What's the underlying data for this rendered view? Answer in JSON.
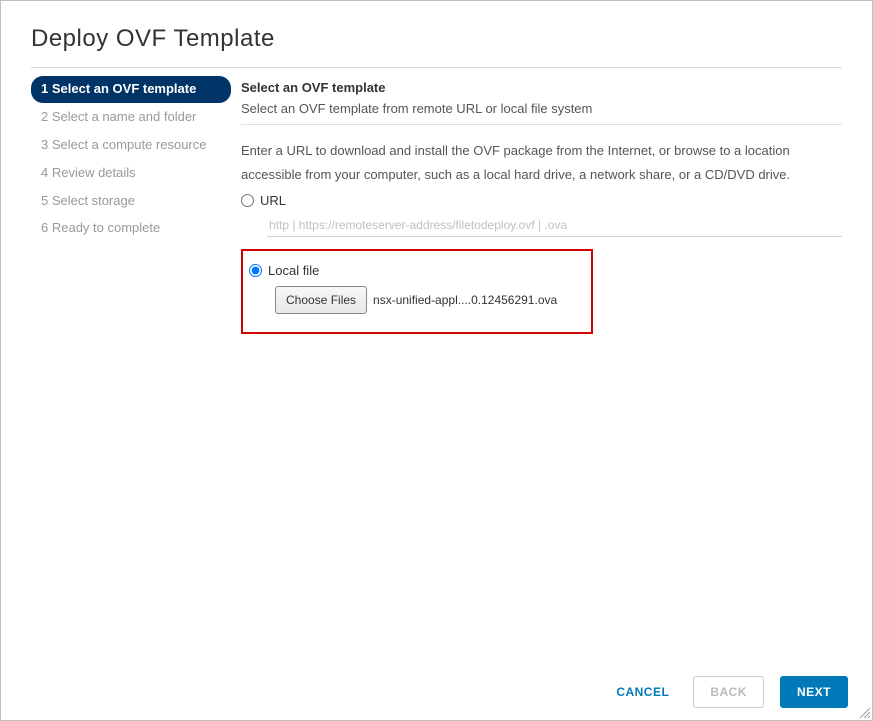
{
  "title": "Deploy OVF Template",
  "steps": [
    "1 Select an OVF template",
    "2 Select a name and folder",
    "3 Select a compute resource",
    "4 Review details",
    "5 Select storage",
    "6 Ready to complete"
  ],
  "active_step_index": 0,
  "section": {
    "heading": "Select an OVF template",
    "sub": "Select an OVF template from remote URL or local file system",
    "help": "Enter a URL to download and install the OVF package from the Internet, or browse to a location accessible from your computer, such as a local hard drive, a network share, or a CD/DVD drive."
  },
  "url_option": {
    "label": "URL",
    "placeholder": "http | https://remoteserver-address/filetodeploy.ovf | .ova",
    "selected": false
  },
  "local_option": {
    "label": "Local file",
    "choose_label": "Choose Files",
    "file_name": "nsx-unified-appl....0.12456291.ova",
    "selected": true
  },
  "footer": {
    "cancel": "CANCEL",
    "back": "BACK",
    "next": "NEXT"
  }
}
